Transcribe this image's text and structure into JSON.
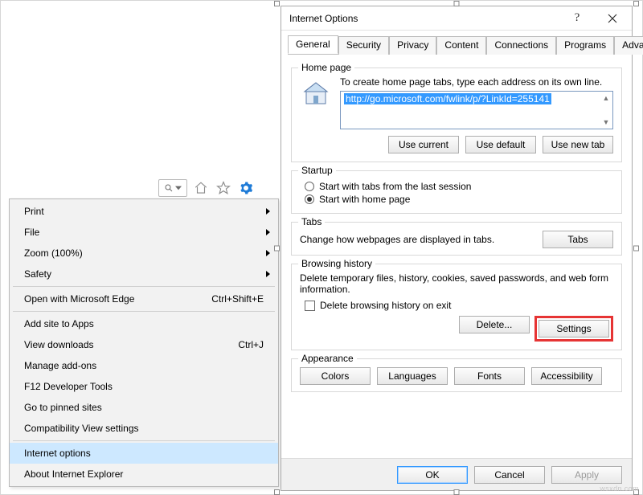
{
  "toolbar": {
    "icons": {
      "search": "search-icon",
      "dropdown": "chevron-down-icon",
      "home": "home-icon",
      "star": "star-icon",
      "gear": "gear-icon"
    }
  },
  "menu": {
    "items": [
      {
        "label": "Print",
        "submenu": true
      },
      {
        "label": "File",
        "submenu": true
      },
      {
        "label": "Zoom (100%)",
        "submenu": true
      },
      {
        "label": "Safety",
        "submenu": true
      },
      {
        "sep": true
      },
      {
        "label": "Open with Microsoft Edge",
        "accel": "Ctrl+Shift+E"
      },
      {
        "sep": true
      },
      {
        "label": "Add site to Apps"
      },
      {
        "label": "View downloads",
        "accel": "Ctrl+J"
      },
      {
        "label": "Manage add-ons"
      },
      {
        "label": "F12 Developer Tools"
      },
      {
        "label": "Go to pinned sites"
      },
      {
        "label": "Compatibility View settings"
      },
      {
        "sep": true
      },
      {
        "label": "Internet options",
        "selected": true
      },
      {
        "label": "About Internet Explorer"
      }
    ]
  },
  "dialog": {
    "title": "Internet Options",
    "tabs": [
      "General",
      "Security",
      "Privacy",
      "Content",
      "Connections",
      "Programs",
      "Advanced"
    ],
    "active_tab": 0,
    "home_page": {
      "legend": "Home page",
      "hint": "To create home page tabs, type each address on its own line.",
      "url": "http://go.microsoft.com/fwlink/p/?LinkId=255141",
      "buttons": {
        "use_current": "Use current",
        "use_default": "Use default",
        "use_new_tab": "Use new tab"
      }
    },
    "startup": {
      "legend": "Startup",
      "opt_last": "Start with tabs from the last session",
      "opt_home": "Start with home page",
      "selected": "home"
    },
    "tabs_group": {
      "legend": "Tabs",
      "text": "Change how webpages are displayed in tabs.",
      "button": "Tabs"
    },
    "browsing_history": {
      "legend": "Browsing history",
      "text": "Delete temporary files, history, cookies, saved passwords, and web form information.",
      "checkbox_label": "Delete browsing history on exit",
      "delete": "Delete...",
      "settings": "Settings"
    },
    "appearance": {
      "legend": "Appearance",
      "colors": "Colors",
      "languages": "Languages",
      "fonts": "Fonts",
      "accessibility": "Accessibility"
    },
    "footer": {
      "ok": "OK",
      "cancel": "Cancel",
      "apply": "Apply"
    }
  },
  "watermark": "wsxdn.com"
}
